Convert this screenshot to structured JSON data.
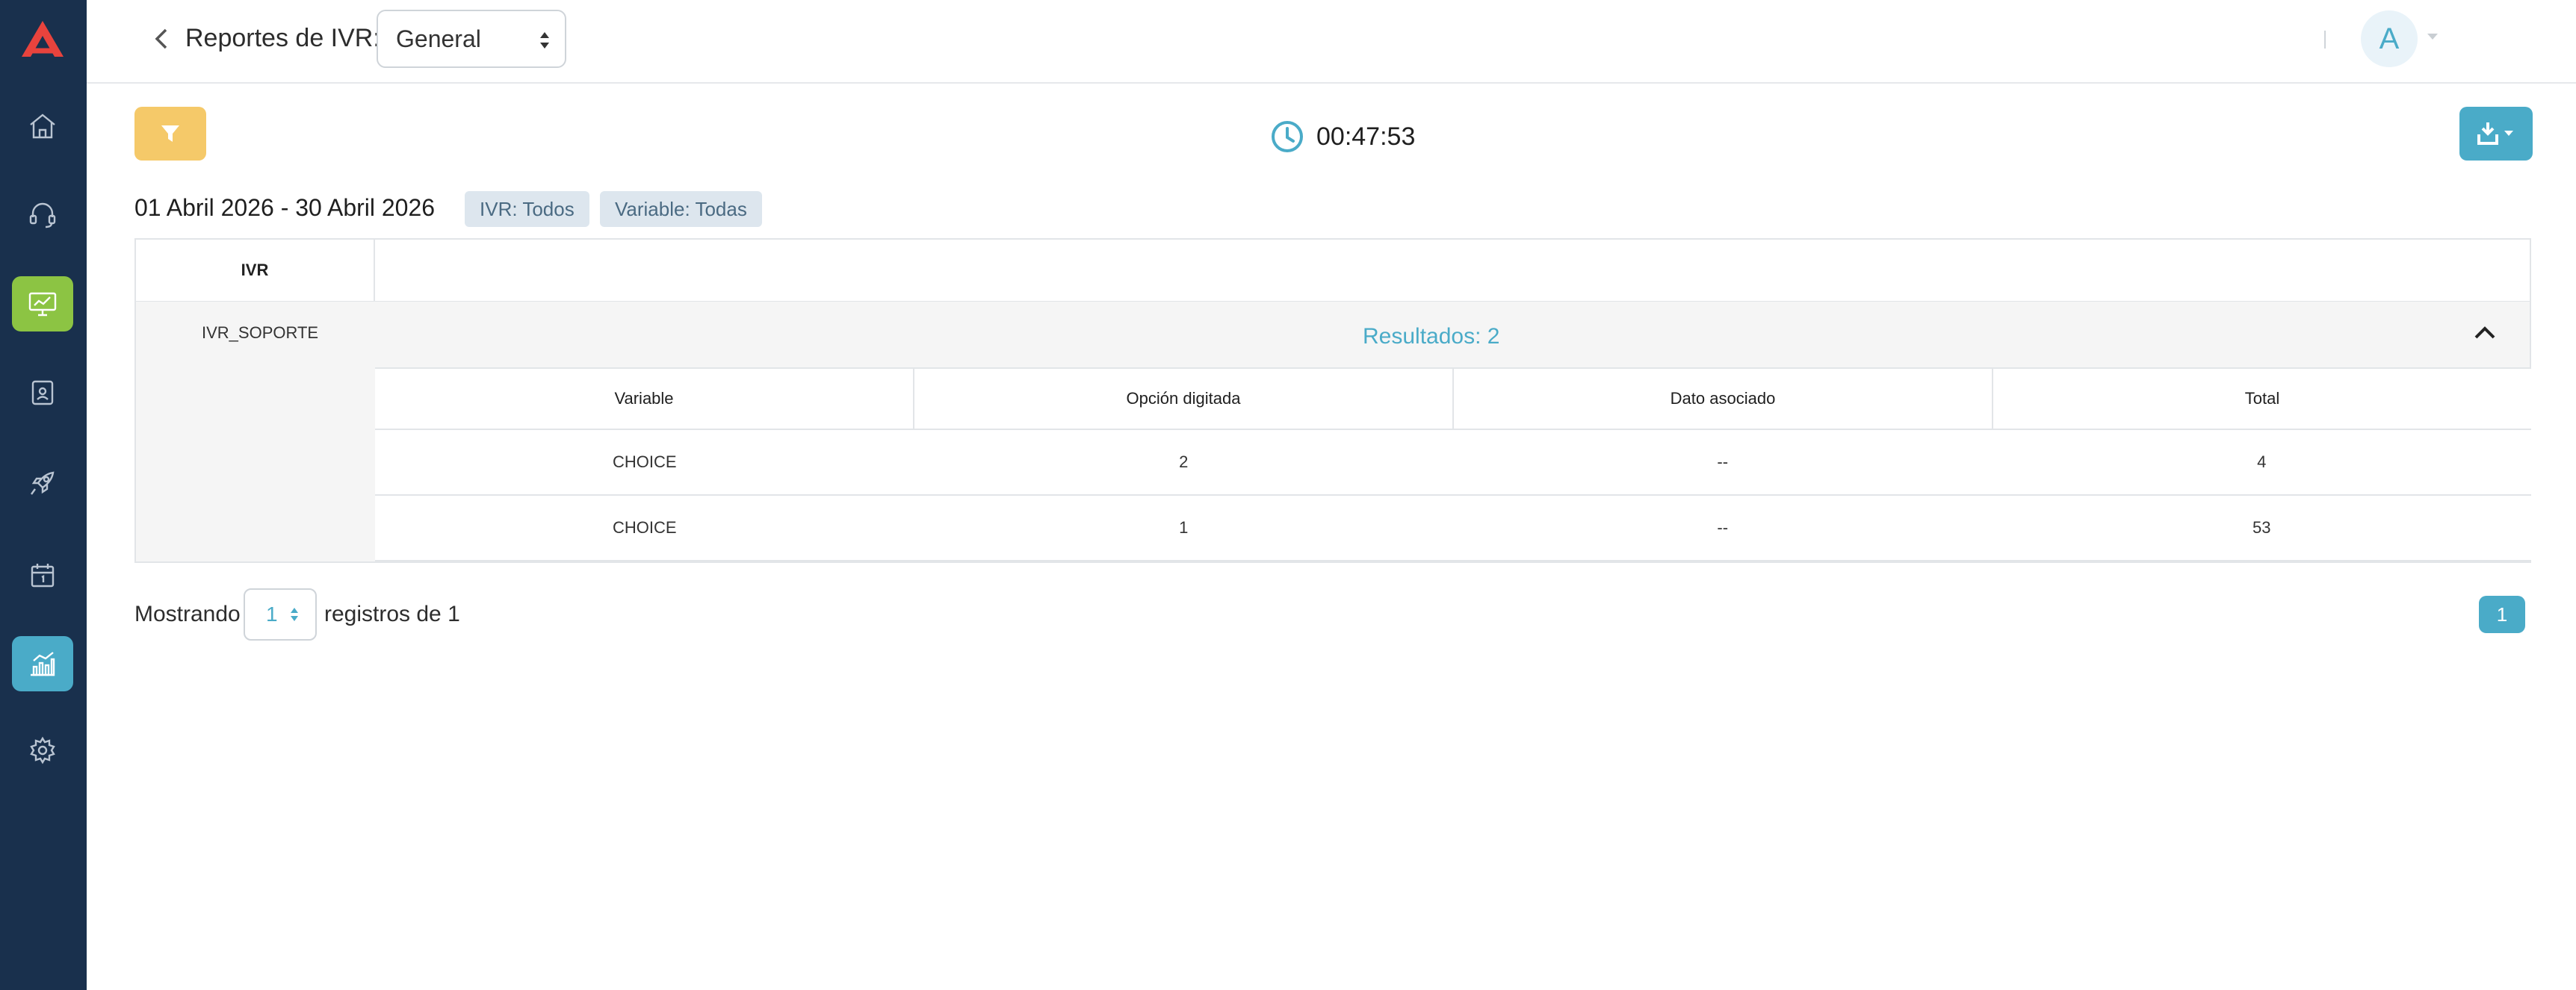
{
  "header": {
    "title": "Reportes de IVR:",
    "report_select": "General",
    "avatar_initial": "A"
  },
  "sidebar": {
    "items": [
      {
        "icon": "home-icon"
      },
      {
        "icon": "headset-icon"
      },
      {
        "icon": "monitor-icon",
        "active": "green"
      },
      {
        "icon": "contacts-icon"
      },
      {
        "icon": "campaign-icon"
      },
      {
        "icon": "calendar-icon"
      },
      {
        "icon": "reports-chart-icon",
        "active": "blue"
      },
      {
        "icon": "settings-icon"
      }
    ]
  },
  "toolbar": {
    "timer": "00:47:53"
  },
  "filters": {
    "range": "01 Abril 2026 - 30 Abril 2026",
    "badges": [
      "IVR: Todos",
      "Variable: Todas"
    ]
  },
  "table": {
    "header": "IVR",
    "group_name": "IVR_SOPORTE",
    "results_label": "Resultados: 2",
    "columns": [
      "Variable",
      "Opción digitada",
      "Dato asociado",
      "Total"
    ],
    "rows": [
      [
        "CHOICE",
        "2",
        "--",
        "4"
      ],
      [
        "CHOICE",
        "1",
        "--",
        "53"
      ]
    ]
  },
  "pagination": {
    "showing_label": "Mostrando",
    "page_size": "1",
    "records_label": "registros de 1",
    "current_page": "1"
  },
  "colors": {
    "sidebar_bg": "#19304d",
    "accent_blue": "#4aabc8",
    "accent_green": "#8cc443",
    "filter_yellow": "#f5c969",
    "logo_red": "#e8433d"
  }
}
